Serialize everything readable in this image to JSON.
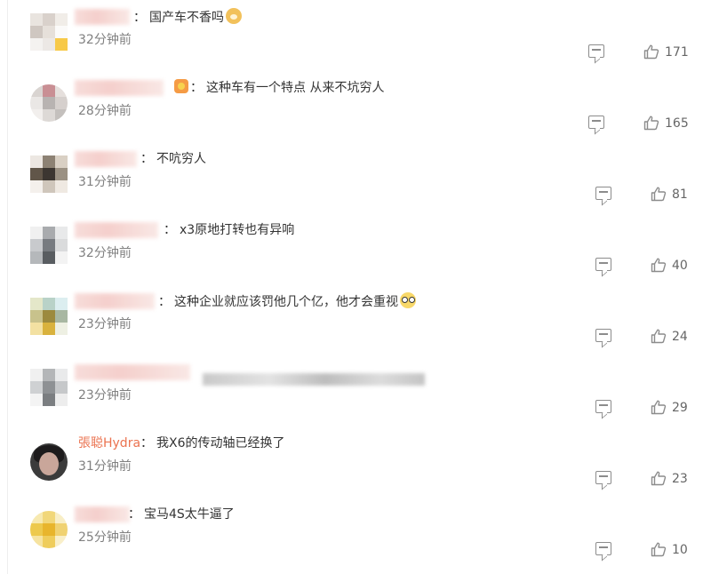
{
  "comments": [
    {
      "text": "国产车不香吗",
      "emoji": "doge-emoji",
      "time": "32分钟前",
      "likes": "171"
    },
    {
      "text": "这种车有一个特点 从来不坑穷人",
      "badge": "vip-badge",
      "time": "28分钟前",
      "likes": "165"
    },
    {
      "text": "不吭穷人",
      "time": "31分钟前",
      "likes": "81"
    },
    {
      "text": "x3原地打转也有异响",
      "time": "32分钟前",
      "likes": "40"
    },
    {
      "text": "这种企业就应该罚他几个亿，他才会重视",
      "emoji": "glasses-emoji",
      "time": "23分钟前",
      "likes": "24"
    },
    {
      "text": "",
      "time": "23分钟前",
      "likes": "29"
    },
    {
      "username": "張聪Hydra",
      "text": "我X6的传动轴已经换了",
      "time": "31分钟前",
      "likes": "23"
    },
    {
      "text": "宝马4S太牛逼了",
      "time": "25分钟前",
      "likes": "10"
    }
  ],
  "colon": "：",
  "colors": {
    "username": "#eb7350",
    "time": "#808080",
    "text": "#333333",
    "icon": "#8c8c8c"
  }
}
